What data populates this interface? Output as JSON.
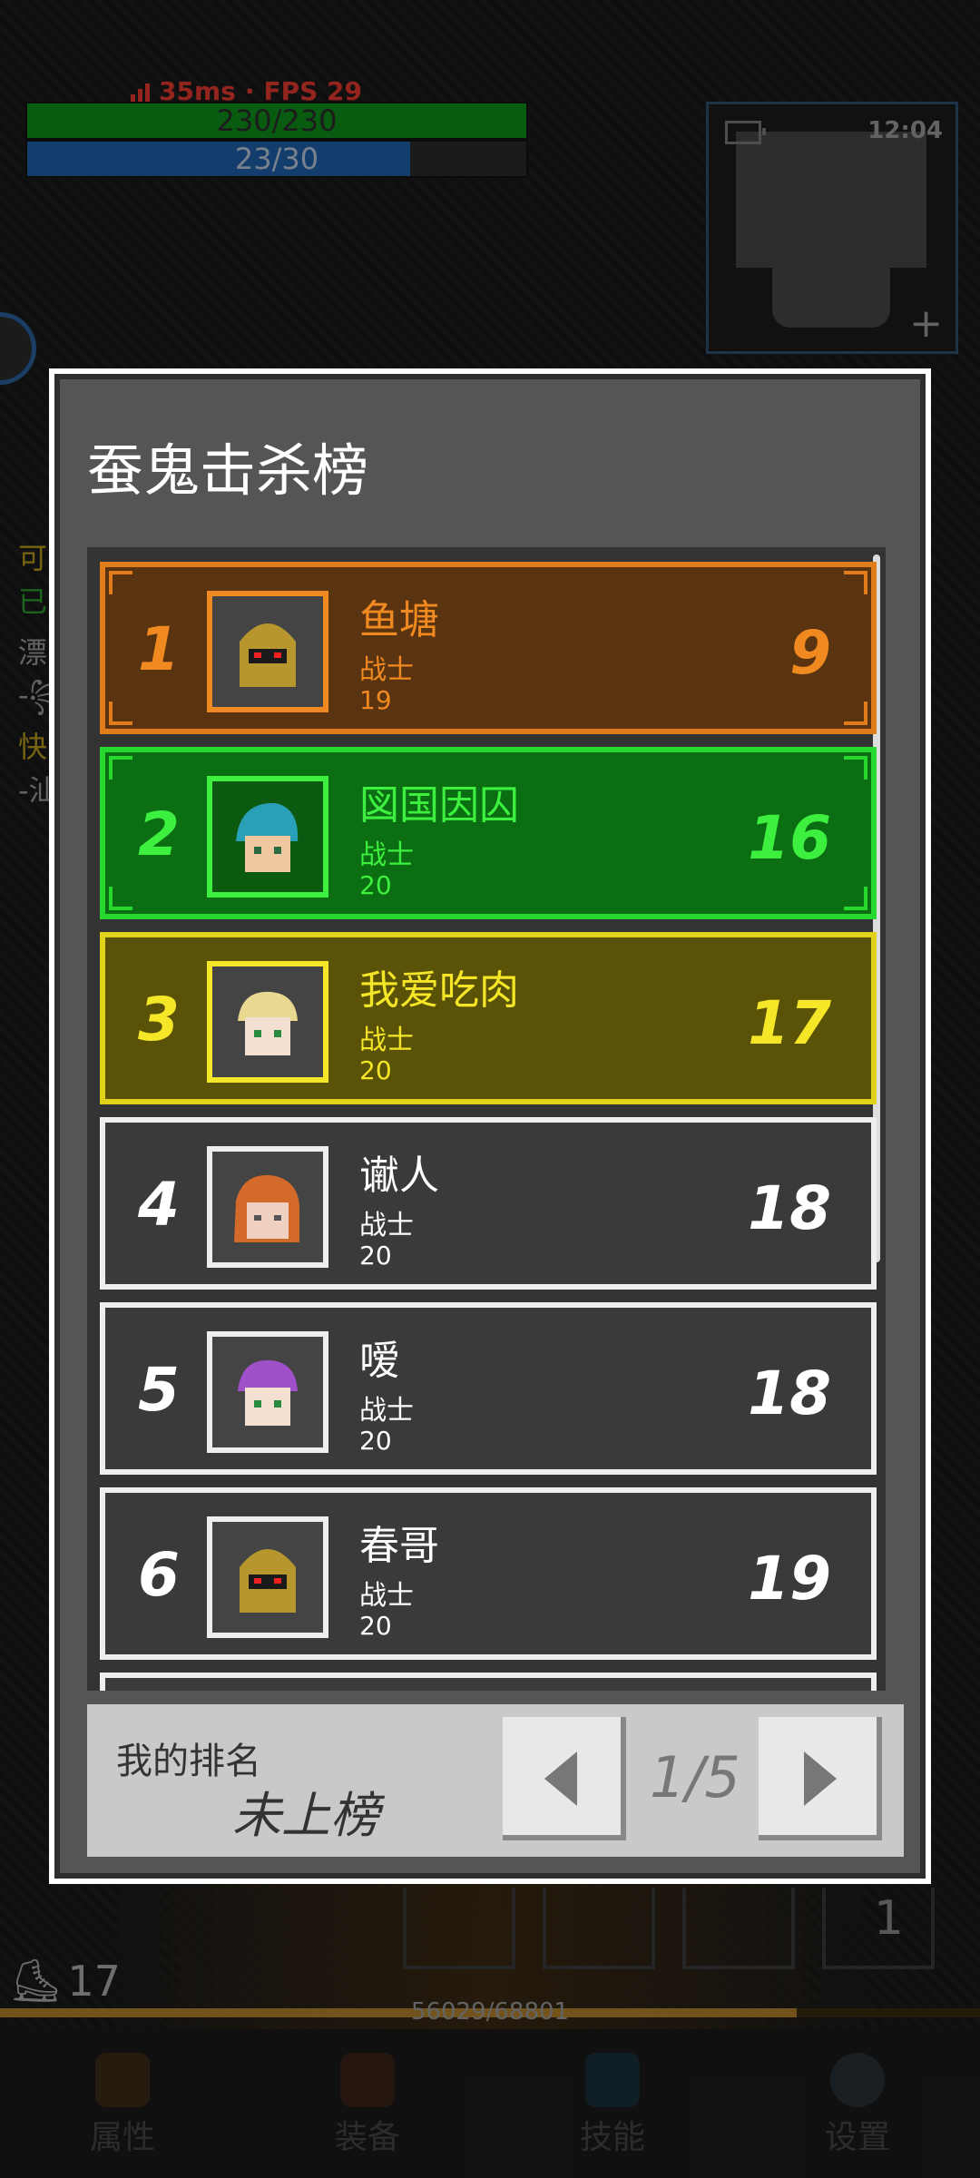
{
  "hud": {
    "ping": "35ms",
    "fps": "FPS 29",
    "hp": "230/230",
    "mp": "23/30",
    "clock": "12:04",
    "side_lines": [
      "可",
      "已",
      "漂",
      "-꧂",
      "快",
      "-汕"
    ]
  },
  "leaderboard": {
    "title": "蚕鬼击杀榜",
    "rows": [
      {
        "rank": "1",
        "name": "鱼塘",
        "class": "战士",
        "level": "19",
        "kills": "9"
      },
      {
        "rank": "2",
        "name": "図国因囚",
        "class": "战士",
        "level": "20",
        "kills": "16"
      },
      {
        "rank": "3",
        "name": "我爱吃肉",
        "class": "战士",
        "level": "20",
        "kills": "17"
      },
      {
        "rank": "4",
        "name": "谳人",
        "class": "战士",
        "level": "20",
        "kills": "18"
      },
      {
        "rank": "5",
        "name": "嗳",
        "class": "战士",
        "level": "20",
        "kills": "18"
      },
      {
        "rank": "6",
        "name": "春哥",
        "class": "战士",
        "level": "20",
        "kills": "19"
      }
    ],
    "my_rank_label": "我的排名",
    "my_rank_value": "未上榜",
    "page": "1/5"
  },
  "bottom": {
    "level": "17",
    "exp": "56029/68801",
    "slot_number": "1",
    "nav": [
      "属性",
      "装备",
      "技能",
      "设置"
    ]
  },
  "colors": {
    "gold": "#f08a20",
    "green": "#3df040",
    "yellow": "#f5e628",
    "hp": "#0f8c1a",
    "mp": "#1d5ea8"
  }
}
